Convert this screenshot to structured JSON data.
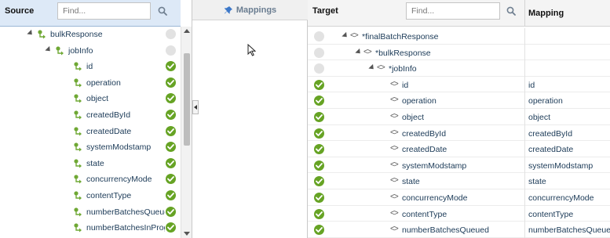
{
  "source": {
    "title": "Source",
    "find_placeholder": "Find...",
    "rows": [
      {
        "label": "bulkResponse",
        "indent": 1,
        "expanded": true,
        "status": "unmapped"
      },
      {
        "label": "jobInfo",
        "indent": 2,
        "expanded": true,
        "status": "unmapped"
      },
      {
        "label": "id",
        "indent": 3,
        "expanded": false,
        "status": "mapped"
      },
      {
        "label": "operation",
        "indent": 3,
        "expanded": false,
        "status": "mapped"
      },
      {
        "label": "object",
        "indent": 3,
        "expanded": false,
        "status": "mapped"
      },
      {
        "label": "createdById",
        "indent": 3,
        "expanded": false,
        "status": "mapped"
      },
      {
        "label": "createdDate",
        "indent": 3,
        "expanded": false,
        "status": "mapped"
      },
      {
        "label": "systemModstamp",
        "indent": 3,
        "expanded": false,
        "status": "mapped"
      },
      {
        "label": "state",
        "indent": 3,
        "expanded": false,
        "status": "mapped"
      },
      {
        "label": "concurrencyMode",
        "indent": 3,
        "expanded": false,
        "status": "mapped"
      },
      {
        "label": "contentType",
        "indent": 3,
        "expanded": false,
        "status": "mapped"
      },
      {
        "label": "numberBatchesQueued",
        "indent": 3,
        "expanded": false,
        "status": "mapped"
      },
      {
        "label": "numberBatchesInProgress",
        "indent": 3,
        "expanded": false,
        "status": "mapped"
      }
    ]
  },
  "mappings": {
    "title": "Mappings"
  },
  "target": {
    "title": "Target",
    "find_placeholder": "Find...",
    "mapping_column_title": "Mapping",
    "rows": [
      {
        "label": "*finalBatchResponse",
        "indent": 1,
        "expanded": true,
        "status": "unmapped",
        "mapping": ""
      },
      {
        "label": "*bulkResponse",
        "indent": 2,
        "expanded": true,
        "status": "unmapped",
        "mapping": ""
      },
      {
        "label": "*jobInfo",
        "indent": 3,
        "expanded": true,
        "status": "unmapped",
        "mapping": ""
      },
      {
        "label": "id",
        "indent": 4,
        "expanded": false,
        "status": "mapped",
        "mapping": "id"
      },
      {
        "label": "operation",
        "indent": 4,
        "expanded": false,
        "status": "mapped",
        "mapping": "operation"
      },
      {
        "label": "object",
        "indent": 4,
        "expanded": false,
        "status": "mapped",
        "mapping": "object"
      },
      {
        "label": "createdById",
        "indent": 4,
        "expanded": false,
        "status": "mapped",
        "mapping": "createdById"
      },
      {
        "label": "createdDate",
        "indent": 4,
        "expanded": false,
        "status": "mapped",
        "mapping": "createdDate"
      },
      {
        "label": "systemModstamp",
        "indent": 4,
        "expanded": false,
        "status": "mapped",
        "mapping": "systemModstamp"
      },
      {
        "label": "state",
        "indent": 4,
        "expanded": false,
        "status": "mapped",
        "mapping": "state"
      },
      {
        "label": "concurrencyMode",
        "indent": 4,
        "expanded": false,
        "status": "mapped",
        "mapping": "concurrencyMode"
      },
      {
        "label": "contentType",
        "indent": 4,
        "expanded": false,
        "status": "mapped",
        "mapping": "contentType"
      },
      {
        "label": "numberBatchesQueued",
        "indent": 4,
        "expanded": false,
        "status": "mapped",
        "mapping": "numberBatchesQueued"
      }
    ]
  },
  "icons": {
    "search": "search-icon",
    "source_field": "source-field-icon",
    "target_element": "xml-element-icon",
    "mapped_status": "check-circle-icon",
    "unmapped_status": "empty-circle-icon",
    "mappings": "pin-icon"
  },
  "colors": {
    "mapped": "#66a324",
    "unmapped": "#e2e2e2",
    "source_header": "#dde9f7",
    "label_text": "#1b3a57"
  }
}
